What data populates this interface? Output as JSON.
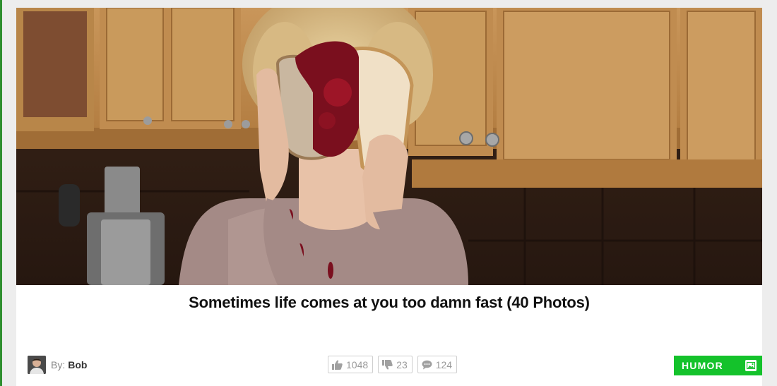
{
  "post": {
    "title": "Sometimes life comes at you too damn fast (40 Photos)",
    "image_alt": "Woman in kitchen with bread and jam smashed on her face",
    "author": {
      "by_label": "By:",
      "name": "Bob"
    },
    "stats": {
      "likes": "1048",
      "dislikes": "23",
      "comments": "124"
    },
    "category": {
      "label": "HUMOR",
      "icon": "image-icon"
    }
  },
  "colors": {
    "accent_green": "#14c22b",
    "edge_green": "#2f8f2f",
    "background": "#ededed"
  }
}
